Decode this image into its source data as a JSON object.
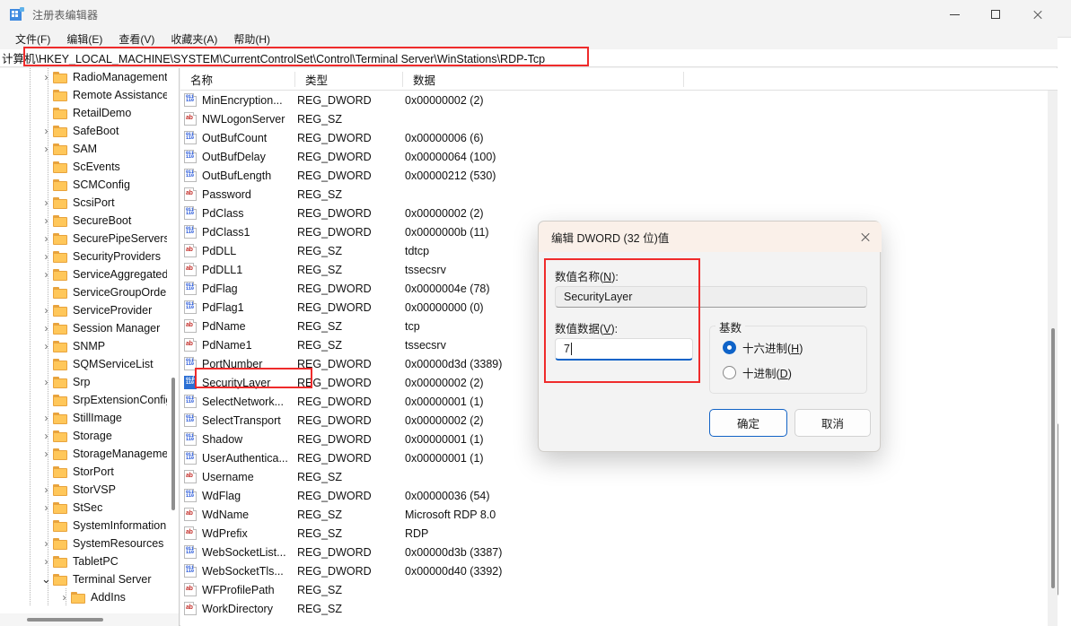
{
  "window": {
    "title": "注册表编辑器",
    "app_icon": "registry-editor-icon",
    "controls": {
      "minimize": "最小化",
      "maximize": "最大化",
      "close": "关闭"
    }
  },
  "menubar": [
    {
      "label": "文件(F)"
    },
    {
      "label": "编辑(E)"
    },
    {
      "label": "查看(V)"
    },
    {
      "label": "收藏夹(A)"
    },
    {
      "label": "帮助(H)"
    }
  ],
  "address": {
    "prefix": "计算机\\",
    "path": "HKEY_LOCAL_MACHINE\\SYSTEM\\CurrentControlSet\\Control\\Terminal Server\\WinStations\\RDP-Tcp",
    "full": "计算机\\HKEY_LOCAL_MACHINE\\SYSTEM\\CurrentControlSet\\Control\\Terminal Server\\WinStations\\RDP-Tcp"
  },
  "tree": {
    "items": [
      {
        "label": "RadioManagement",
        "expandable": true,
        "expanded": false,
        "depth": 0
      },
      {
        "label": "Remote Assistance",
        "expandable": false,
        "expanded": false,
        "depth": 0
      },
      {
        "label": "RetailDemo",
        "expandable": false,
        "expanded": false,
        "depth": 0
      },
      {
        "label": "SafeBoot",
        "expandable": true,
        "expanded": false,
        "depth": 0
      },
      {
        "label": "SAM",
        "expandable": true,
        "expanded": false,
        "depth": 0
      },
      {
        "label": "ScEvents",
        "expandable": false,
        "expanded": false,
        "depth": 0
      },
      {
        "label": "SCMConfig",
        "expandable": false,
        "expanded": false,
        "depth": 0
      },
      {
        "label": "ScsiPort",
        "expandable": true,
        "expanded": false,
        "depth": 0
      },
      {
        "label": "SecureBoot",
        "expandable": true,
        "expanded": false,
        "depth": 0
      },
      {
        "label": "SecurePipeServers",
        "expandable": true,
        "expanded": false,
        "depth": 0
      },
      {
        "label": "SecurityProviders",
        "expandable": true,
        "expanded": false,
        "depth": 0
      },
      {
        "label": "ServiceAggregated",
        "expandable": true,
        "expanded": false,
        "depth": 0
      },
      {
        "label": "ServiceGroupOrder",
        "expandable": false,
        "expanded": false,
        "depth": 0
      },
      {
        "label": "ServiceProvider",
        "expandable": true,
        "expanded": false,
        "depth": 0
      },
      {
        "label": "Session Manager",
        "expandable": true,
        "expanded": false,
        "depth": 0
      },
      {
        "label": "SNMP",
        "expandable": true,
        "expanded": false,
        "depth": 0
      },
      {
        "label": "SQMServiceList",
        "expandable": false,
        "expanded": false,
        "depth": 0
      },
      {
        "label": "Srp",
        "expandable": true,
        "expanded": false,
        "depth": 0
      },
      {
        "label": "SrpExtensionConfig",
        "expandable": false,
        "expanded": false,
        "depth": 0
      },
      {
        "label": "StillImage",
        "expandable": true,
        "expanded": false,
        "depth": 0
      },
      {
        "label": "Storage",
        "expandable": true,
        "expanded": false,
        "depth": 0
      },
      {
        "label": "StorageManagement",
        "expandable": true,
        "expanded": false,
        "depth": 0
      },
      {
        "label": "StorPort",
        "expandable": false,
        "expanded": false,
        "depth": 0
      },
      {
        "label": "StorVSP",
        "expandable": true,
        "expanded": false,
        "depth": 0
      },
      {
        "label": "StSec",
        "expandable": true,
        "expanded": false,
        "depth": 0
      },
      {
        "label": "SystemInformation",
        "expandable": false,
        "expanded": false,
        "depth": 0
      },
      {
        "label": "SystemResources",
        "expandable": true,
        "expanded": false,
        "depth": 0
      },
      {
        "label": "TabletPC",
        "expandable": true,
        "expanded": false,
        "depth": 0
      },
      {
        "label": "Terminal Server",
        "expandable": true,
        "expanded": true,
        "depth": 0
      },
      {
        "label": "AddIns",
        "expandable": true,
        "expanded": false,
        "depth": 1
      }
    ]
  },
  "list": {
    "columns": [
      {
        "key": "name",
        "label": "名称"
      },
      {
        "key": "type",
        "label": "类型"
      },
      {
        "key": "data",
        "label": "数据"
      }
    ],
    "rows": [
      {
        "name": "MinEncryption...",
        "type": "REG_DWORD",
        "data": "0x00000002 (2)",
        "icon": "dword",
        "selected": false
      },
      {
        "name": "NWLogonServer",
        "type": "REG_SZ",
        "data": "",
        "icon": "sz",
        "selected": false
      },
      {
        "name": "OutBufCount",
        "type": "REG_DWORD",
        "data": "0x00000006 (6)",
        "icon": "dword",
        "selected": false
      },
      {
        "name": "OutBufDelay",
        "type": "REG_DWORD",
        "data": "0x00000064 (100)",
        "icon": "dword",
        "selected": false
      },
      {
        "name": "OutBufLength",
        "type": "REG_DWORD",
        "data": "0x00000212 (530)",
        "icon": "dword",
        "selected": false
      },
      {
        "name": "Password",
        "type": "REG_SZ",
        "data": "",
        "icon": "sz",
        "selected": false
      },
      {
        "name": "PdClass",
        "type": "REG_DWORD",
        "data": "0x00000002 (2)",
        "icon": "dword",
        "selected": false
      },
      {
        "name": "PdClass1",
        "type": "REG_DWORD",
        "data": "0x0000000b (11)",
        "icon": "dword",
        "selected": false
      },
      {
        "name": "PdDLL",
        "type": "REG_SZ",
        "data": "tdtcp",
        "icon": "sz",
        "selected": false
      },
      {
        "name": "PdDLL1",
        "type": "REG_SZ",
        "data": "tssecsrv",
        "icon": "sz",
        "selected": false
      },
      {
        "name": "PdFlag",
        "type": "REG_DWORD",
        "data": "0x0000004e (78)",
        "icon": "dword",
        "selected": false
      },
      {
        "name": "PdFlag1",
        "type": "REG_DWORD",
        "data": "0x00000000 (0)",
        "icon": "dword",
        "selected": false
      },
      {
        "name": "PdName",
        "type": "REG_SZ",
        "data": "tcp",
        "icon": "sz",
        "selected": false
      },
      {
        "name": "PdName1",
        "type": "REG_SZ",
        "data": "tssecsrv",
        "icon": "sz",
        "selected": false
      },
      {
        "name": "PortNumber",
        "type": "REG_DWORD",
        "data": "0x00000d3d (3389)",
        "icon": "dword",
        "selected": false
      },
      {
        "name": "SecurityLayer",
        "type": "REG_DWORD",
        "data": "0x00000002 (2)",
        "icon": "dword",
        "selected": true
      },
      {
        "name": "SelectNetwork...",
        "type": "REG_DWORD",
        "data": "0x00000001 (1)",
        "icon": "dword",
        "selected": false
      },
      {
        "name": "SelectTransport",
        "type": "REG_DWORD",
        "data": "0x00000002 (2)",
        "icon": "dword",
        "selected": false
      },
      {
        "name": "Shadow",
        "type": "REG_DWORD",
        "data": "0x00000001 (1)",
        "icon": "dword",
        "selected": false
      },
      {
        "name": "UserAuthentica...",
        "type": "REG_DWORD",
        "data": "0x00000001 (1)",
        "icon": "dword",
        "selected": false
      },
      {
        "name": "Username",
        "type": "REG_SZ",
        "data": "",
        "icon": "sz",
        "selected": false
      },
      {
        "name": "WdFlag",
        "type": "REG_DWORD",
        "data": "0x00000036 (54)",
        "icon": "dword",
        "selected": false
      },
      {
        "name": "WdName",
        "type": "REG_SZ",
        "data": "Microsoft RDP 8.0",
        "icon": "sz",
        "selected": false
      },
      {
        "name": "WdPrefix",
        "type": "REG_SZ",
        "data": "RDP",
        "icon": "sz",
        "selected": false
      },
      {
        "name": "WebSocketList...",
        "type": "REG_DWORD",
        "data": "0x00000d3b (3387)",
        "icon": "dword",
        "selected": false
      },
      {
        "name": "WebSocketTls...",
        "type": "REG_DWORD",
        "data": "0x00000d40 (3392)",
        "icon": "dword",
        "selected": false
      },
      {
        "name": "WFProfilePath",
        "type": "REG_SZ",
        "data": "",
        "icon": "sz",
        "selected": false
      },
      {
        "name": "WorkDirectory",
        "type": "REG_SZ",
        "data": "",
        "icon": "sz",
        "selected": false
      }
    ]
  },
  "dialog": {
    "title": "编辑 DWORD (32 位)值",
    "name_label_pre": "数值名称(",
    "name_label_key": "N",
    "name_label_post": "):",
    "name_value": "SecurityLayer",
    "data_label_pre": "数值数据(",
    "data_label_key": "V",
    "data_label_post": "):",
    "data_value": "7",
    "base_group_title": "基数",
    "radios": [
      {
        "label_pre": "十六进制(",
        "key": "H",
        "label_post": ")",
        "selected": true
      },
      {
        "label_pre": "十进制(",
        "key": "D",
        "label_post": ")",
        "selected": false
      }
    ],
    "ok_label": "确定",
    "cancel_label": "取消"
  },
  "annotations": {
    "address_highlight": "红框-地址栏",
    "securitylayer_highlight": "红框-SecurityLayer项",
    "dialog_fields_highlight": "红框-数值名称与数值数据"
  },
  "colors": {
    "accent": "#0f63c8",
    "annotation_red": "#ef2b2b",
    "folder": "#ffc75a",
    "dword_icon_blue": "#1c4fd8",
    "sz_icon_red": "#c4302b",
    "selection_blue": "#2b6fd4"
  }
}
